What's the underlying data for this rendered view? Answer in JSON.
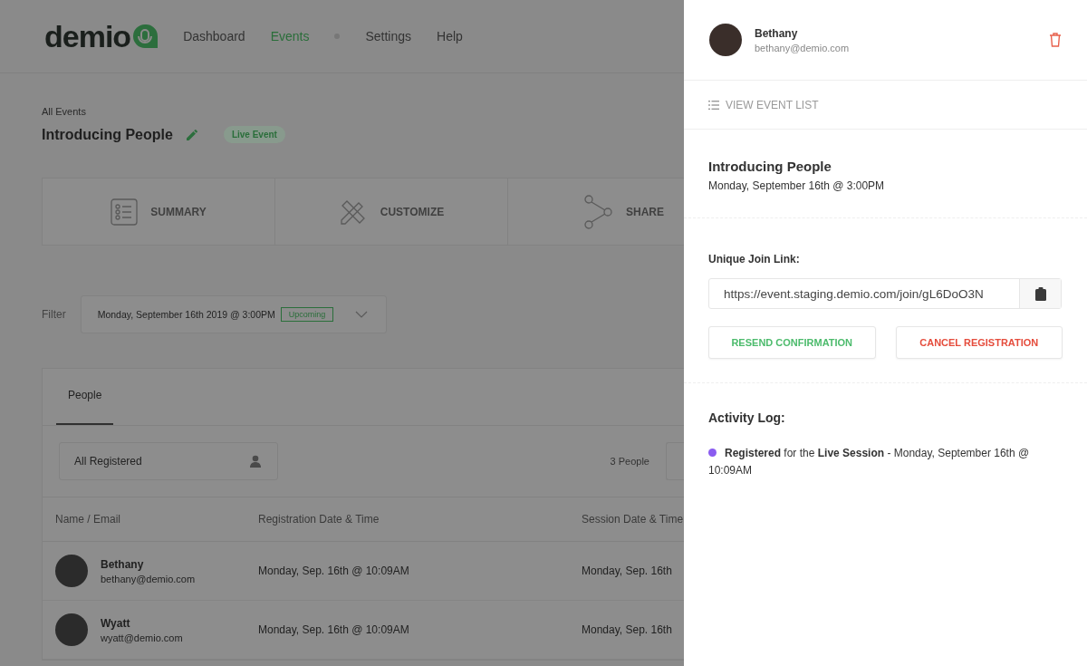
{
  "logo": {
    "text": "demio"
  },
  "nav": [
    {
      "kind": "link",
      "label": "Dashboard",
      "selected": false
    },
    {
      "kind": "link",
      "label": "Events",
      "selected": true
    },
    {
      "kind": "dot"
    },
    {
      "kind": "link",
      "label": "Settings",
      "selected": false
    },
    {
      "kind": "link",
      "label": "Help",
      "selected": false
    }
  ],
  "breadcrumb": "All Events",
  "event": {
    "title": "Introducing People",
    "badge": "Live Event"
  },
  "sections": [
    {
      "label": "SUMMARY"
    },
    {
      "label": "CUSTOMIZE"
    },
    {
      "label": "SHARE"
    }
  ],
  "filter": {
    "label": "Filter",
    "value": "Monday, September 16th 2019 @ 3:00PM",
    "status": "Upcoming"
  },
  "people": {
    "tabs": [
      {
        "label": "People",
        "selected": true
      }
    ],
    "segment": "All Registered",
    "count": "3 People",
    "columns": [
      "Name / Email",
      "Registration Date & Time",
      "Session Date & Time"
    ],
    "rows": [
      {
        "name": "Bethany",
        "email": "bethany@demio.com",
        "registered": "Monday, Sep. 16th @ 10:09AM",
        "session": "Monday, Sep. 16th"
      },
      {
        "name": "Wyatt",
        "email": "wyatt@demio.com",
        "registered": "Monday, Sep. 16th @ 10:09AM",
        "session": "Monday, Sep. 16th"
      }
    ]
  },
  "drawer": {
    "name": "Bethany",
    "email": "bethany@demio.com",
    "view_list": "VIEW EVENT LIST",
    "event_title": "Introducing People",
    "event_date": "Monday, September 16th @ 3:00PM",
    "join_label": "Unique Join Link:",
    "join_link": "https://event.staging.demio.com/join/gL6DoO3N",
    "buttons": [
      {
        "kind": "positive",
        "label": "RESEND CONFIRMATION"
      },
      {
        "kind": "danger",
        "label": "CANCEL REGISTRATION"
      }
    ],
    "activity_title": "Activity Log:",
    "activity": [
      {
        "color": "#8a5cf0",
        "text": "**Registered** for the **Live Session** - Monday, September 16th @ 10:09AM"
      }
    ]
  }
}
